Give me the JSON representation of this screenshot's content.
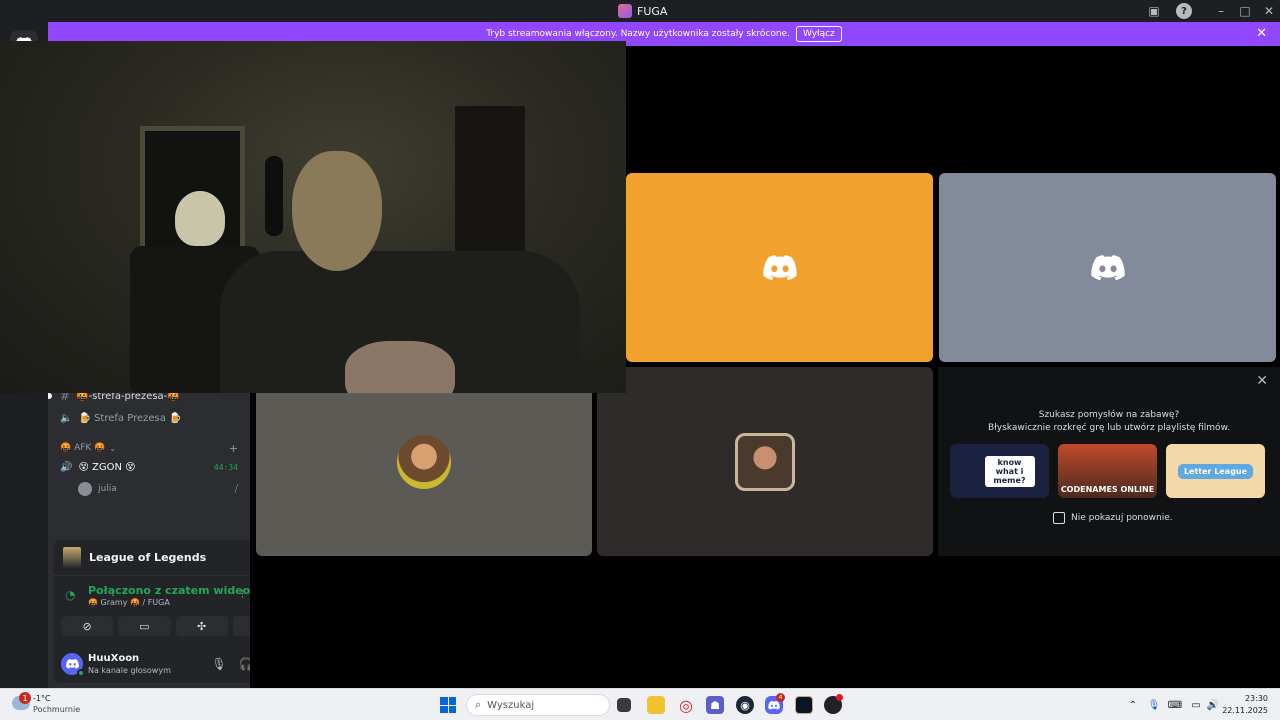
{
  "window": {
    "title": "FUGA"
  },
  "banner": {
    "text": "Tryb streamowania włączony. Nazwy użytkownika zostały skrócone.",
    "button": "Wyłącz"
  },
  "sidebar": {
    "channels": [
      {
        "icon": "text-channel-icon",
        "label": "🤬-strefa-prezesa-🤬"
      },
      {
        "icon": "voice-channel-icon",
        "label": "🍺 Strefa Prezesa 🍺"
      }
    ],
    "category": {
      "label": "🤬 AFK 🤬"
    },
    "voice_channel": {
      "label": "😵 ZGON 😵",
      "timer": "44:34"
    },
    "voice_member": {
      "name": "julia"
    }
  },
  "user_panel": {
    "game": "League of Legends",
    "voice_status": "Połączono z czatem wideo",
    "voice_location": "🤬 Gramy 🤬 / FUGA",
    "username": "HuuXoon",
    "user_status": "Na kanale głosowym"
  },
  "stage": {
    "tiles": [
      {
        "name": "tile-orange",
        "color": "#f0a22c"
      },
      {
        "name": "tile-gray",
        "color": "#838a9c"
      }
    ]
  },
  "suggest": {
    "line1": "Szukasz pomysłów na zabawę?",
    "line2": "Błyskawicznie rozkręć grę lub utwórz playlistę filmów.",
    "cards": [
      {
        "label": "know what i meme?",
        "color": "#1a2240"
      },
      {
        "label": "CODENAMES ONLINE",
        "color": "#c14a2a"
      },
      {
        "label": "Letter League",
        "color": "#f2d8a6"
      }
    ],
    "dont_show": "Nie pokazuj ponownie."
  },
  "taskbar": {
    "weather_badge": "1",
    "temperature": "-1°C",
    "condition": "Pochmurnie",
    "search_placeholder": "Wyszukaj",
    "discord_badge": "4",
    "time": "23:30",
    "date": "22.11.2025"
  }
}
